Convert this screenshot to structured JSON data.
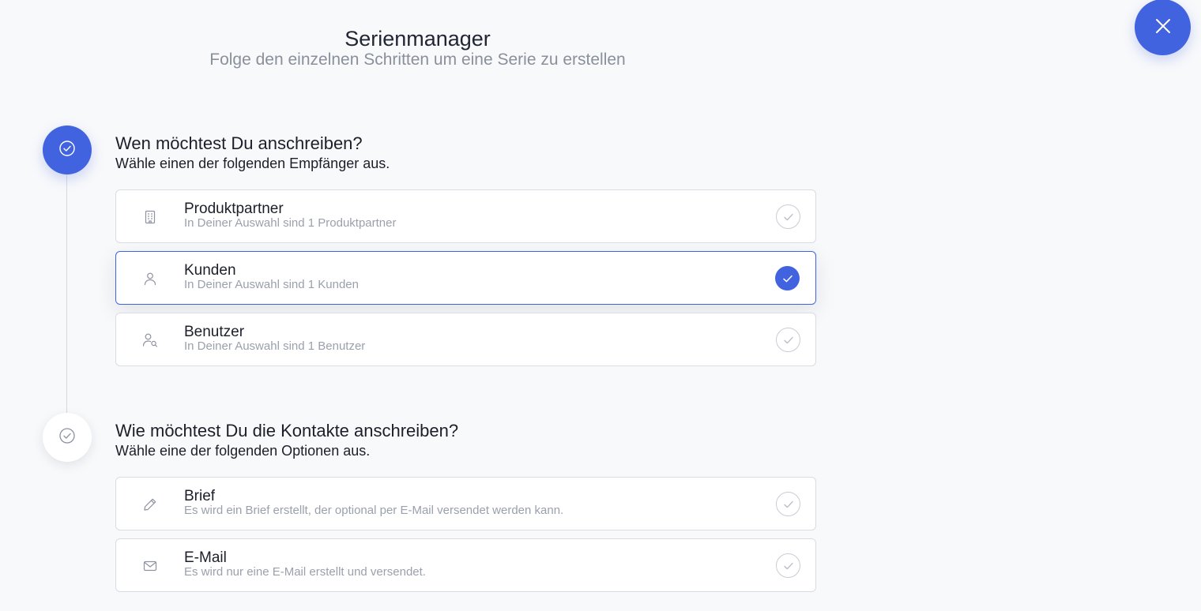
{
  "header": {
    "title": "Serienmanager",
    "subtitle": "Folge den einzelnen Schritten um eine Serie zu erstellen"
  },
  "close_button": {
    "icon": "close-icon"
  },
  "steps": [
    {
      "status": "active",
      "question": "Wen möchtest Du anschreiben?",
      "hint": "Wähle einen der folgenden Empfänger aus.",
      "options": [
        {
          "icon": "building-icon",
          "title": "Produktpartner",
          "description": "In Deiner Auswahl sind 1 Produktpartner",
          "selected": false
        },
        {
          "icon": "person-icon",
          "title": "Kunden",
          "description": "In Deiner Auswahl sind 1 Kunden",
          "selected": true
        },
        {
          "icon": "user-search-icon",
          "title": "Benutzer",
          "description": "In Deiner Auswahl sind 1 Benutzer",
          "selected": false
        }
      ]
    },
    {
      "status": "inactive",
      "question": "Wie möchtest Du die Kontakte anschreiben?",
      "hint": "Wähle eine der folgenden Optionen aus.",
      "options": [
        {
          "icon": "pencil-icon",
          "title": "Brief",
          "description": "Es wird ein Brief erstellt, der optional per E-Mail versendet werden kann.",
          "selected": false
        },
        {
          "icon": "envelope-icon",
          "title": "E-Mail",
          "description": "Es wird nur eine E-Mail erstellt und versendet.",
          "selected": false
        }
      ]
    }
  ],
  "colors": {
    "accent": "#4263e0",
    "background": "#f8f9fb",
    "text": "#1c1f2a",
    "muted": "#9aa0ac",
    "border": "#d9dce3"
  }
}
